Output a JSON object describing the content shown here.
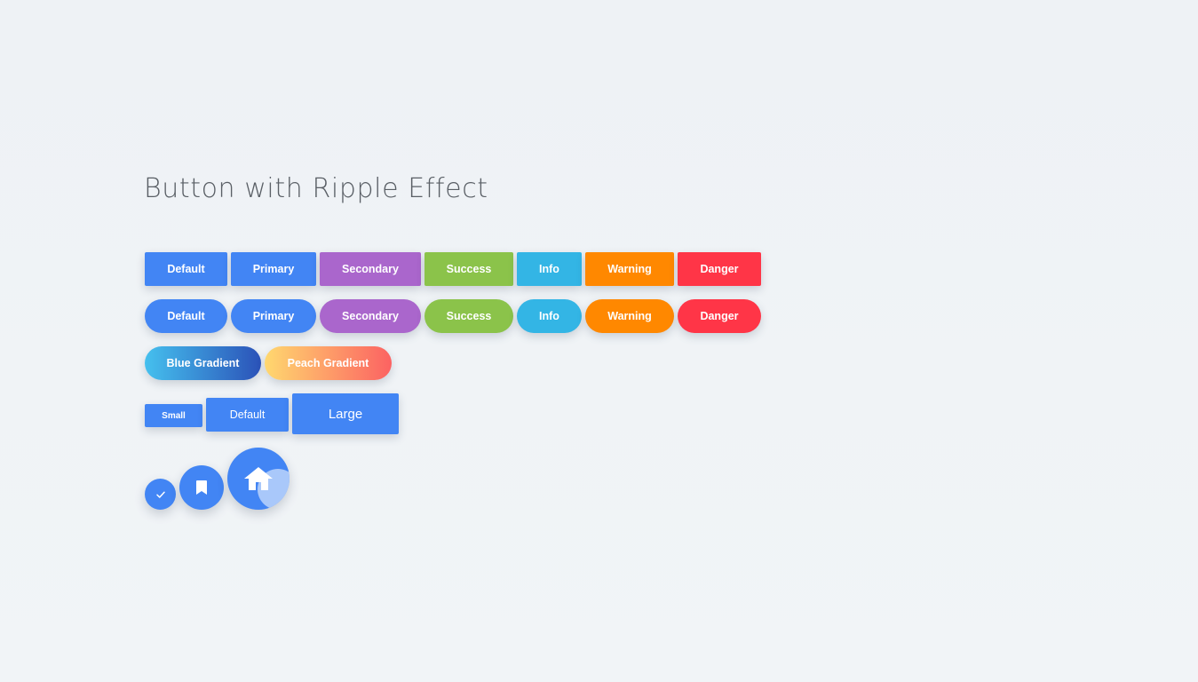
{
  "page": {
    "title": "Button with Ripple Effect"
  },
  "rows": {
    "flat": [
      "Default",
      "Primary",
      "Secondary",
      "Success",
      "Info",
      "Warning",
      "Danger"
    ],
    "rounded": [
      "Default",
      "Primary",
      "Secondary",
      "Success",
      "Info",
      "Warning",
      "Danger"
    ],
    "gradient": [
      "Blue Gradient",
      "Peach Gradient"
    ],
    "sizes": [
      "Small",
      "Default",
      "Large"
    ]
  },
  "icons": {
    "fab_small": "check-icon",
    "fab_medium": "bookmark-icon",
    "fab_large": "home-icon"
  },
  "colors": {
    "default": "#4285f4",
    "primary": "#4285f4",
    "secondary": "#aa66cc",
    "success": "#8bc34a",
    "info": "#33b5e5",
    "warning": "#ff8800",
    "danger": "#ff3547",
    "background": "#eff2f5",
    "title": "#5a5f66"
  }
}
